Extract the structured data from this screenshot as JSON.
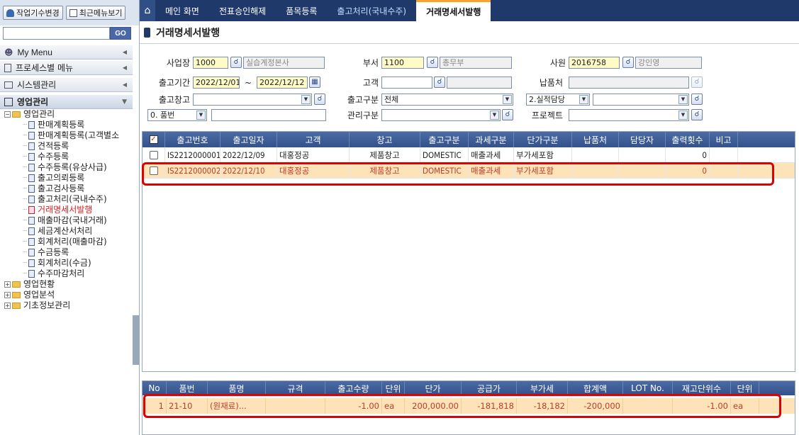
{
  "sidebar": {
    "top_buttons": [
      "작업기수변경",
      "최근메뉴보기"
    ],
    "search_value": "",
    "search_button": "GO",
    "menus": [
      {
        "label": "My Menu"
      },
      {
        "label": "프로세스별 메뉴"
      },
      {
        "label": "시스템관리"
      },
      {
        "label": "영업관리"
      }
    ],
    "tree": {
      "root": "영업관리",
      "items": [
        "판매계획등록",
        "판매계획등록(고객별소",
        "견적등록",
        "수주등록",
        "수주등록(유상사급)",
        "출고의뢰등록",
        "출고검사등록",
        "출고처리(국내수주)",
        "거래명세서발행",
        "매출마감(국내거래)",
        "세금계산서처리",
        "회계처리(매출마감)",
        "수금등록",
        "회계처리(수금)",
        "수주마감처리"
      ],
      "selected_index": 8,
      "folders": [
        "영업현황",
        "영업분석",
        "기초정보관리"
      ]
    }
  },
  "tabs": [
    "메인 화면",
    "전표승인해제",
    "품목등록",
    "출고처리(국내수주)",
    "거래명세서발행"
  ],
  "page_title": "거래명세서발행",
  "form": {
    "site_label": "사업장",
    "site_code": "1000",
    "site_name": "실습계정본사",
    "dept_label": "부서",
    "dept_code": "1100",
    "dept_name": "총무부",
    "emp_label": "사원",
    "emp_code": "2016758",
    "emp_name": "강인영",
    "period_label": "출고기간",
    "date_from": "2022/12/01",
    "tilde": "~",
    "date_to": "2022/12/12",
    "customer_label": "고객",
    "customer_value": "",
    "delivery_label": "납품처",
    "delivery_value": "",
    "warehouse_label": "출고창고",
    "warehouse_value": "",
    "type_label": "출고구분",
    "type_value": "전체",
    "perf_value": "2.실적담당",
    "perf_input": "",
    "item_select": "0. 품번",
    "item_input": "",
    "mgmt_label": "관리구분",
    "mgmt_value": "",
    "project_label": "프로젝트",
    "project_value": ""
  },
  "grid": {
    "columns": [
      "출고번호",
      "출고일자",
      "고객",
      "창고",
      "출고구분",
      "과세구분",
      "단가구분",
      "납품처",
      "담당자",
      "출력횟수",
      "비고"
    ],
    "rows": [
      [
        "IS2212000001",
        "2022/12/09",
        "대홍정공",
        "제품창고",
        "DOMESTIC",
        "매출과세",
        "부가세포함",
        "",
        "",
        "0",
        ""
      ],
      [
        "IS2212000002",
        "2022/12/10",
        "대홍정공",
        "제품창고",
        "DOMESTIC",
        "매출과세",
        "부가세포함",
        "",
        "",
        "0",
        ""
      ]
    ]
  },
  "detail": {
    "columns": [
      "No",
      "품번",
      "품명",
      "규격",
      "출고수량",
      "단위",
      "단가",
      "공급가",
      "부가세",
      "합계액",
      "LOT No.",
      "재고단위수",
      "단위"
    ],
    "row": [
      "1",
      "21-10",
      "(원재료)...",
      "",
      "-1.00",
      "ea",
      "200,000.00",
      "-181,818",
      "-18,182",
      "-200,000",
      "",
      "-1.00",
      "ea"
    ]
  },
  "colors": {
    "nav": "#1f3a6a",
    "highlight_row": "#fde3b7",
    "annotation": "#e00000"
  }
}
